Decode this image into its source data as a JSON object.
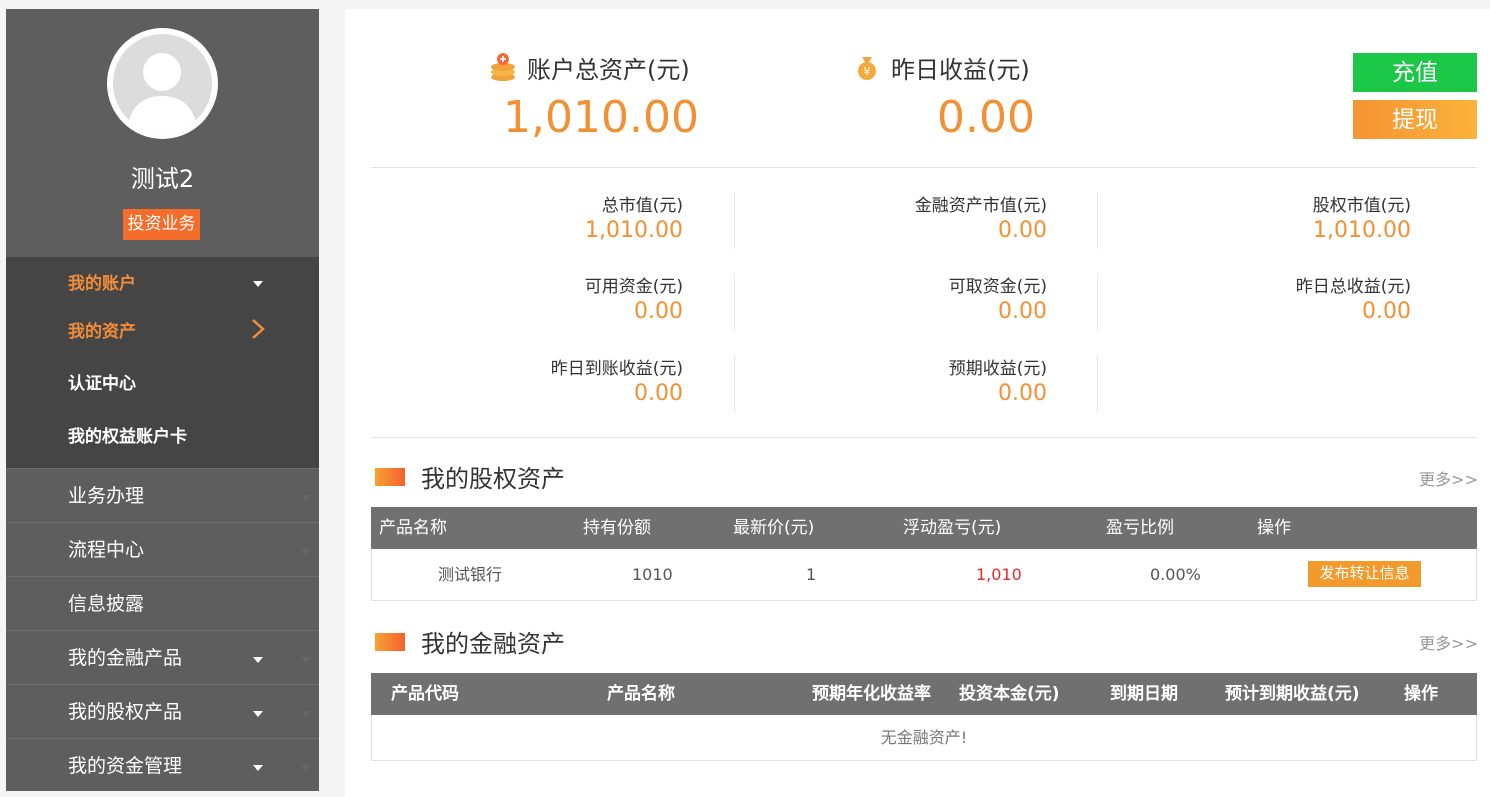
{
  "sidebar": {
    "username": "测试2",
    "role_badge": "投资业务",
    "sub_items": [
      "我的账户",
      "我的资产",
      "认证中心",
      "我的权益账户卡"
    ],
    "nav_items": [
      "业务办理",
      "流程中心",
      "信息披露",
      "我的金融产品",
      "我的股权产品",
      "我的资金管理"
    ]
  },
  "summary": {
    "total_assets_label": "账户总资产(元)",
    "total_assets_value": "1,010.00",
    "yesterday_income_label": "昨日收益(元)",
    "yesterday_income_value": "0.00",
    "charge_label": "充值",
    "withdraw_label": "提现"
  },
  "stats": [
    {
      "label": "总市值(元)",
      "value": "1,010.00"
    },
    {
      "label": "金融资产市值(元)",
      "value": "0.00"
    },
    {
      "label": "股权市值(元)",
      "value": "1,010.00"
    },
    {
      "label": "可用资金(元)",
      "value": "0.00"
    },
    {
      "label": "可取资金(元)",
      "value": "0.00"
    },
    {
      "label": "昨日总收益(元)",
      "value": "0.00"
    },
    {
      "label": "昨日到账收益(元)",
      "value": "0.00"
    },
    {
      "label": "预期收益(元)",
      "value": "0.00"
    }
  ],
  "equity": {
    "title": "我的股权资产",
    "more": "更多>>",
    "headers": [
      "产品名称",
      "持有份额",
      "最新价(元)",
      "浮动盈亏(元)",
      "盈亏比例",
      "操作"
    ],
    "row": {
      "name": "测试银行",
      "shares": "1010",
      "price": "1",
      "pnl": "1,010",
      "ratio": "0.00%",
      "action": "发布转让信息"
    }
  },
  "finance": {
    "title": "我的金融资产",
    "more": "更多>>",
    "headers": [
      "产品代码",
      "产品名称",
      "预期年化收益率",
      "投资本金(元)",
      "到期日期",
      "预计到期收益(元)",
      "操作"
    ],
    "empty": "无金融资产!"
  },
  "colors": {
    "accent": "#f39033",
    "green": "#1cc747",
    "badge": "#f46d2a",
    "loss_red": "#e02b2b"
  }
}
